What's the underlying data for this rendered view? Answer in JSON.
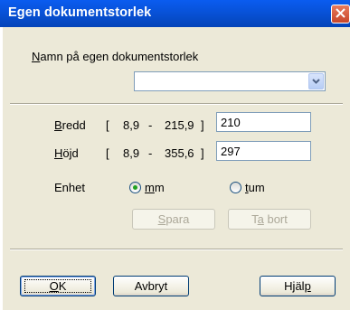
{
  "window": {
    "title": "Egen dokumentstorlek"
  },
  "doc_name": {
    "label_underlined": "N",
    "label_rest": "amn på egen dokumentstorlek",
    "value": ""
  },
  "width": {
    "label_underlined": "B",
    "label_rest": "redd",
    "range_open": "[",
    "range_min": "8,9",
    "range_dash": "-",
    "range_max": "215,9",
    "range_close": "]",
    "value": "210"
  },
  "height": {
    "label_underlined": "H",
    "label_rest": "öjd",
    "range_open": "[",
    "range_min": "8,9",
    "range_dash": "-",
    "range_max": "355,6",
    "range_close": "]",
    "value": "297"
  },
  "unit": {
    "label": "Enhet",
    "options": [
      {
        "underlined": "m",
        "rest": "m",
        "selected": true
      },
      {
        "underlined": "t",
        "rest": "um",
        "selected": false
      }
    ]
  },
  "buttons": {
    "save": {
      "underlined": "S",
      "rest": "para",
      "enabled": false
    },
    "delete": {
      "before": "T",
      "underlined": "a",
      "rest": " bort",
      "enabled": false
    },
    "ok": {
      "underlined": "O",
      "rest": "K"
    },
    "cancel": {
      "label": "Avbryt"
    },
    "help": {
      "before": "Hjäl",
      "underlined": "p"
    }
  },
  "colors": {
    "titlebar": "#0852d8",
    "dialog_bg": "#ece9d8",
    "radio_dot": "#21a121"
  }
}
